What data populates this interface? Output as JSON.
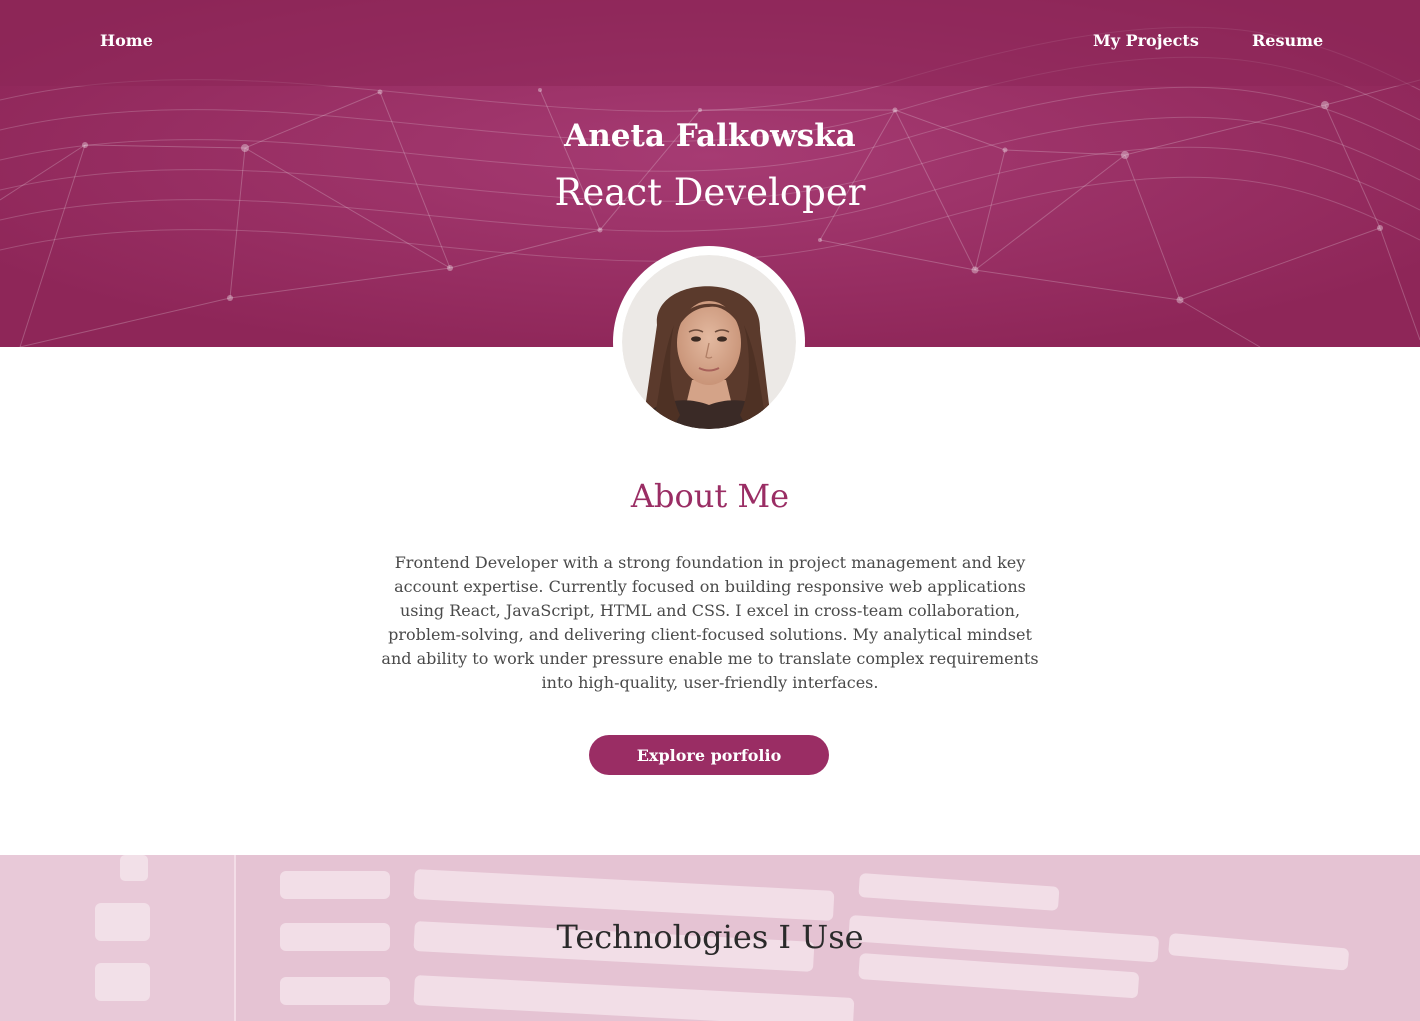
{
  "nav": {
    "home": "Home",
    "projects": "My Projects",
    "resume": "Resume"
  },
  "hero": {
    "name": "Aneta Falkowska",
    "role": "React Developer"
  },
  "about": {
    "title": "About Me",
    "text": "Frontend Developer with a strong foundation in project management and key account expertise. Currently focused on building responsive web applications using React, JavaScript, HTML and CSS. I excel in cross-team collaboration, problem-solving, and delivering client-focused solutions. My analytical mindset and ability to work under pressure enable me to translate complex requirements into high-quality, user-friendly interfaces.",
    "button": "Explore porfolio"
  },
  "tech": {
    "title": "Technologies I Use"
  },
  "colors": {
    "brand": "#9a2d64",
    "hero_bg": "#962c62",
    "tech_bg": "#e5c3d3"
  }
}
